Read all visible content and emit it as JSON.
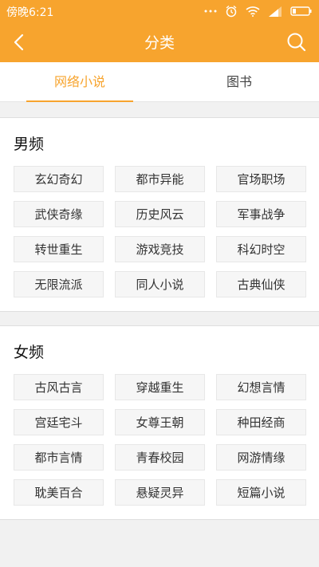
{
  "status_bar": {
    "time": "傍晚6:21",
    "icons": [
      "more-dots-icon",
      "alarm-icon",
      "wifi-icon",
      "signal-icon",
      "battery-icon"
    ]
  },
  "header": {
    "title": "分类",
    "back_icon": "back-arrow-icon",
    "search_icon": "search-icon"
  },
  "tabs": [
    {
      "label": "网络小说",
      "active": true
    },
    {
      "label": "图书",
      "active": false
    }
  ],
  "sections": [
    {
      "title": "男频",
      "tags": [
        "玄幻奇幻",
        "都市异能",
        "官场职场",
        "武侠奇缘",
        "历史风云",
        "军事战争",
        "转世重生",
        "游戏竞技",
        "科幻时空",
        "无限流派",
        "同人小说",
        "古典仙侠"
      ]
    },
    {
      "title": "女频",
      "tags": [
        "古风古言",
        "穿越重生",
        "幻想言情",
        "宫廷宅斗",
        "女尊王朝",
        "种田经商",
        "都市言情",
        "青春校园",
        "网游情缘",
        "耽美百合",
        "悬疑灵异",
        "短篇小说"
      ]
    }
  ],
  "colors": {
    "accent": "#f7a42e",
    "background": "#f1f1f1",
    "tag_bg": "#f6f6f6"
  }
}
